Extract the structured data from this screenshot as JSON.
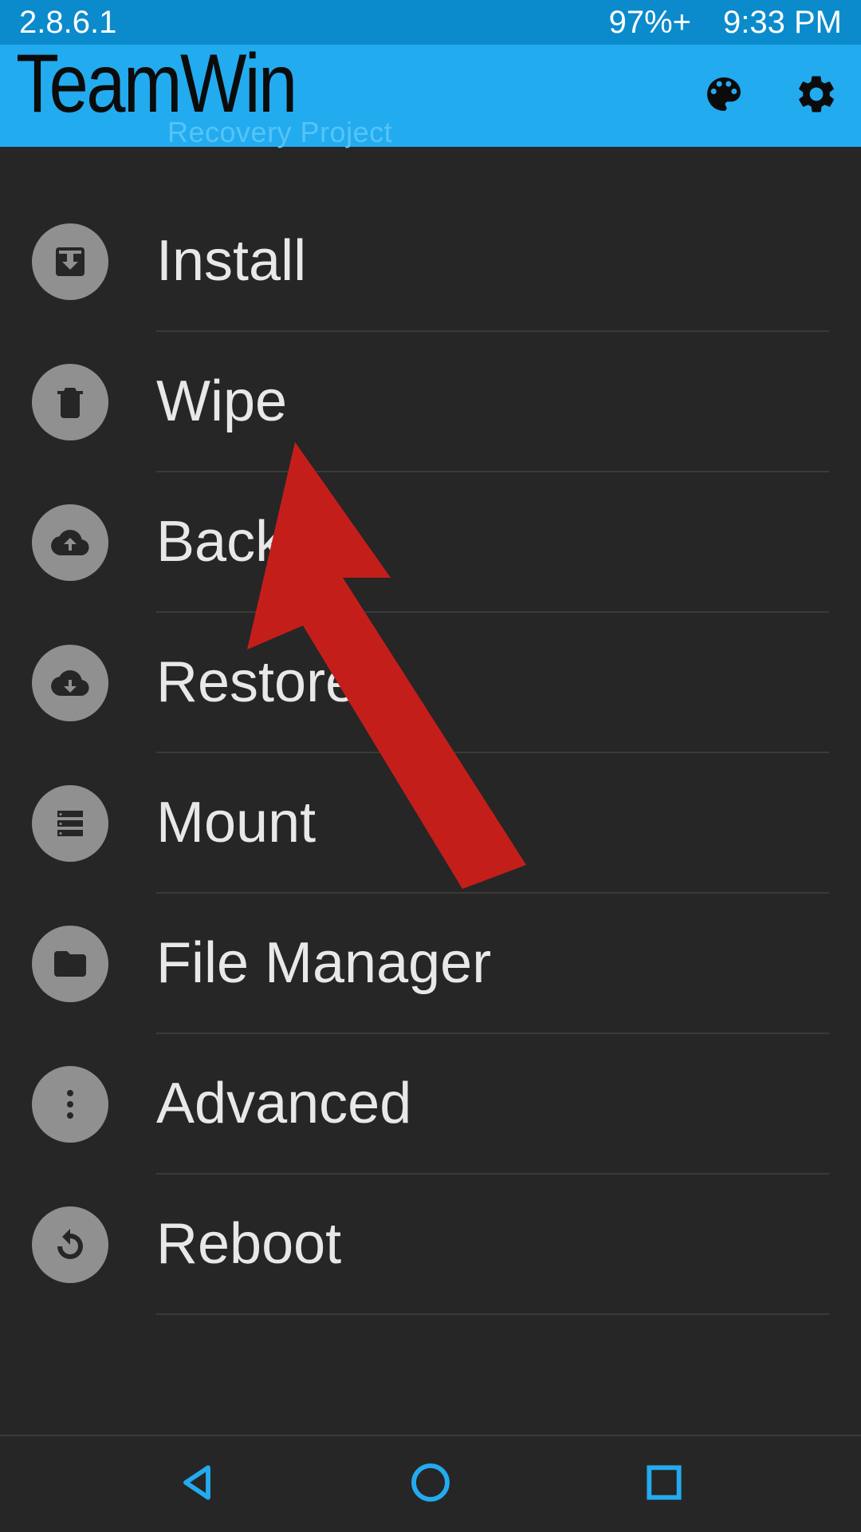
{
  "status": {
    "version": "2.8.6.1",
    "battery": "97%+",
    "time": "9:33 PM"
  },
  "header": {
    "title": "TeamWin",
    "subtitle": "Recovery Project"
  },
  "menu": {
    "items": [
      {
        "id": "install",
        "label": "Install",
        "icon": "download-box-icon"
      },
      {
        "id": "wipe",
        "label": "Wipe",
        "icon": "trash-icon"
      },
      {
        "id": "backup",
        "label": "Backup",
        "icon": "cloud-up-icon"
      },
      {
        "id": "restore",
        "label": "Restore",
        "icon": "cloud-down-icon"
      },
      {
        "id": "mount",
        "label": "Mount",
        "icon": "storage-icon"
      },
      {
        "id": "file-manager",
        "label": "File Manager",
        "icon": "folder-icon"
      },
      {
        "id": "advanced",
        "label": "Advanced",
        "icon": "dots-icon"
      },
      {
        "id": "reboot",
        "label": "Reboot",
        "icon": "refresh-icon"
      }
    ]
  },
  "annotation": {
    "arrow_target": "wipe",
    "arrow_color": "#c41e1b"
  }
}
